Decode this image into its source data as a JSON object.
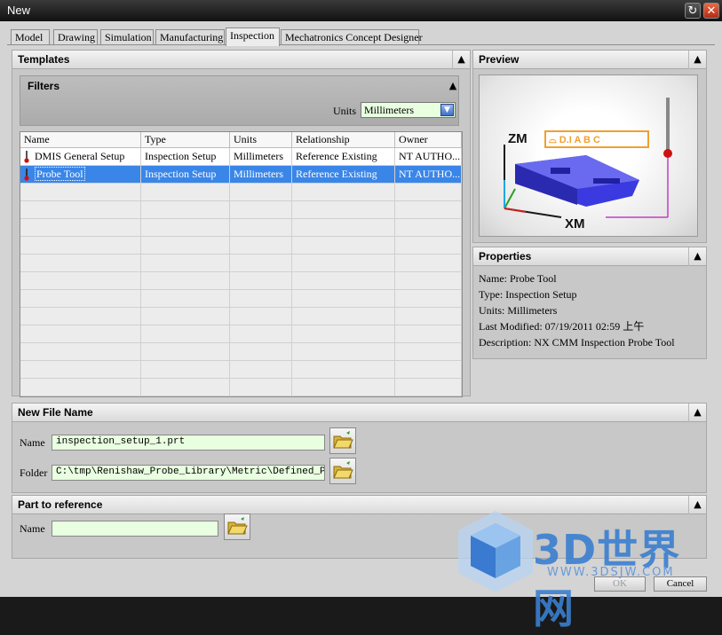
{
  "window": {
    "title": "New",
    "help_glyph": "↻",
    "close_glyph": "✕"
  },
  "tabs": [
    {
      "label": "Model"
    },
    {
      "label": "Drawing"
    },
    {
      "label": "Simulation"
    },
    {
      "label": "Manufacturing"
    },
    {
      "label": "Inspection"
    },
    {
      "label": "Mechatronics Concept Designer"
    }
  ],
  "active_tab": "Inspection",
  "templates": {
    "title": "Templates",
    "filters": {
      "title": "Filters",
      "units_label": "Units",
      "units_value": "Millimeters"
    },
    "columns": [
      "Name",
      "Type",
      "Units",
      "Relationship",
      "Owner"
    ],
    "rows": [
      {
        "name": "DMIS General Setup",
        "type": "Inspection Setup",
        "units": "Millimeters",
        "relationship": "Reference Existing",
        "owner": "NT AUTHO..."
      },
      {
        "name": "Probe Tool",
        "type": "Inspection Setup",
        "units": "Millimeters",
        "relationship": "Reference Existing",
        "owner": "NT AUTHO..."
      }
    ],
    "selected_row": 1
  },
  "preview": {
    "title": "Preview",
    "axis_z": "ZM",
    "axis_x": "XM",
    "fcf_text": "⌓ D.I A B C"
  },
  "properties": {
    "title": "Properties",
    "lines": [
      "Name: Probe Tool",
      "Type: Inspection Setup",
      "Units: Millimeters",
      "Last Modified: 07/19/2011 02:59 上午",
      "Description: NX CMM Inspection Probe Tool"
    ]
  },
  "new_file": {
    "title": "New File Name",
    "name_label": "Name",
    "name_value": "inspection_setup_1.prt",
    "folder_label": "Folder",
    "folder_value": "C:\\tmp\\Renishaw_Probe_Library\\Metric\\Defined_Probes\\"
  },
  "part_ref": {
    "title": "Part to reference",
    "name_label": "Name",
    "name_value": ""
  },
  "buttons": {
    "ok": "OK",
    "cancel": "Cancel"
  },
  "watermark": {
    "text": "3D世界网",
    "url": "WWW.3DSJW.COM"
  },
  "colors": {
    "selection": "#3a86e8",
    "field_bg": "#e8ffe0",
    "watermark": "#3a7fd0"
  }
}
